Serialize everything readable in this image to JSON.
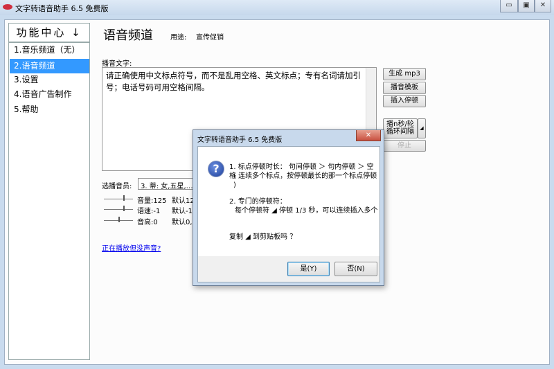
{
  "window": {
    "title": "文字转语音助手 6.5 免费版",
    "min": "▭",
    "max": "▣",
    "close": "✕"
  },
  "sidebar": {
    "header": "功能中心",
    "header_arrow": "↓",
    "items": [
      {
        "label": "1.音乐频道（无）"
      },
      {
        "label": "2.语音频道",
        "selected": true
      },
      {
        "label": "3.设置"
      },
      {
        "label": "4.语音广告制作"
      },
      {
        "label": "5.帮助"
      }
    ]
  },
  "main": {
    "title": "语音频道",
    "purpose_label": "用途:",
    "purpose_value": "宣传促销",
    "text_label": "播音文字:",
    "text_value": "请正确使用中文标点符号，而不是乱用空格、英文标点；专有名词请加引号；电话号码可用空格间隔。",
    "buttons": {
      "generate": "生成 mp3",
      "template": "播音模板",
      "insert_pause": "插入停顿",
      "loop": "播n秒/轮\n循环间隔",
      "loop_menu": "◢",
      "stop": "停止"
    },
    "voice_label": "选播音员:",
    "voice_value": "3. 蒂: 女,五星,…",
    "sliders": [
      {
        "label": "音量:125",
        "default": "默认12…",
        "level": 0.7
      },
      {
        "label": "语速:-1",
        "default": "默认-1,…",
        "level": 0.7
      },
      {
        "label": "音高:0",
        "default": "默认0,…",
        "level": 0.5
      }
    ],
    "link": "正在播放但没声音?"
  },
  "dialog": {
    "title": "文字转语音助手 6.5 免费版",
    "close": "✕",
    "icon": "?",
    "line1": "1. 标点停顿时长： 句间停顿 ＞ 句内停顿 ＞ 空格",
    "line1b": "( 连续多个标点，按停顿最长的那一个标点停顿 )",
    "line2": "2. 专门的停顿符：",
    "line2b": "每个停顿符 ◢ 停顿 1/3 秒，可以连续插入多个",
    "line3": "复制 ◢ 到剪贴板吗 ？",
    "yes": "是(Y)",
    "no": "否(N)"
  }
}
